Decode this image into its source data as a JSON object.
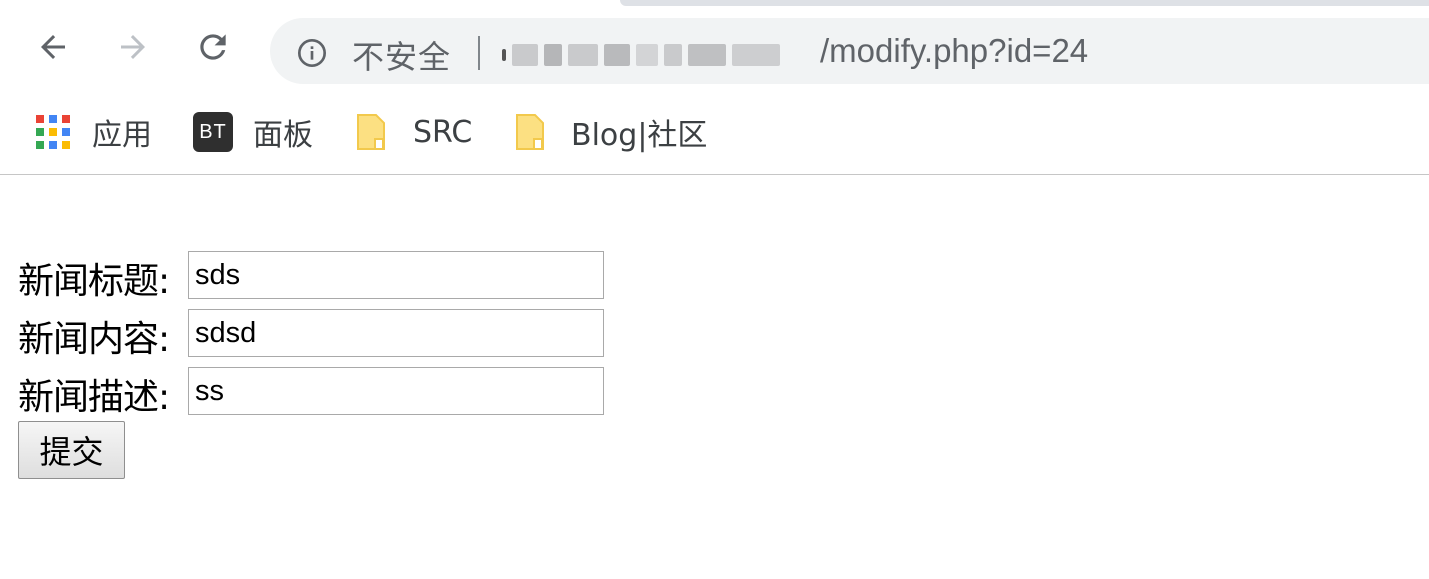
{
  "address_bar": {
    "security_label": "不安全",
    "url_visible": "/modify.php?id=24"
  },
  "bookmarks": [
    {
      "label": "应用",
      "icon": "apps-grid-icon"
    },
    {
      "label": "面板",
      "icon": "bt-panel-icon",
      "icon_text": "BT"
    },
    {
      "label": "SRC",
      "icon": "bookmark-folder-icon"
    },
    {
      "label": "Blog|社区",
      "icon": "bookmark-folder-icon"
    }
  ],
  "form": {
    "title_label": "新闻标题:",
    "title_value": "sds",
    "content_label": "新闻内容:",
    "content_value": "sdsd",
    "desc_label": "新闻描述:",
    "desc_value": "ss",
    "submit_label": "提交"
  },
  "colors": {
    "toolbar_bg": "#ffffff",
    "omnibox_bg": "#f1f3f4",
    "icon_gray": "#5f6368",
    "folder_yellow": "#fce082",
    "input_border": "#a9a9a9"
  }
}
